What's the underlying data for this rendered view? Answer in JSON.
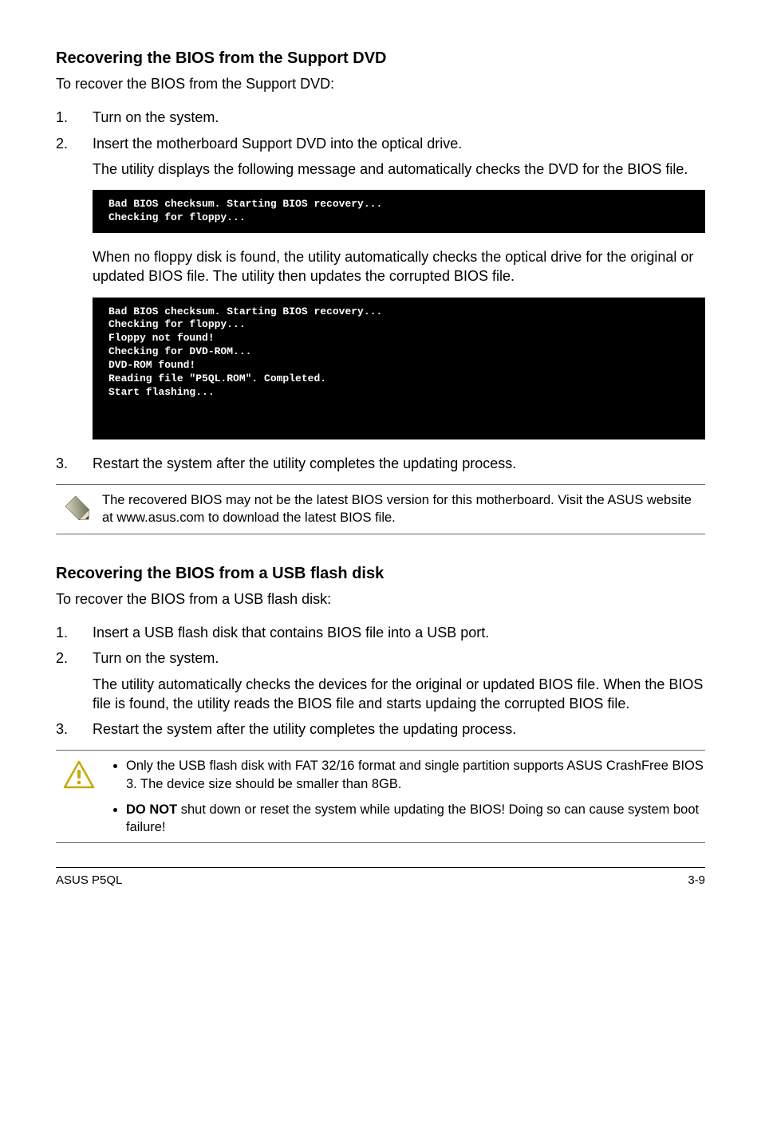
{
  "section1": {
    "heading": "Recovering the BIOS from the Support DVD",
    "intro": "To recover the BIOS from the Support DVD:",
    "steps": [
      {
        "num": "1.",
        "text": "Turn on the system."
      },
      {
        "num": "2.",
        "text": "Insert the motherboard Support DVD into the optical drive.",
        "sub": "The utility displays the following message and automatically checks the DVD for the BIOS file."
      }
    ],
    "terminal1": "Bad BIOS checksum. Starting BIOS recovery...\nChecking for floppy...",
    "mid_p": "When no floppy disk is found, the utility automatically checks the optical drive for the original or updated BIOS file. The utility then updates the corrupted BIOS file.",
    "terminal2": "Bad BIOS checksum. Starting BIOS recovery...\nChecking for floppy...\nFloppy not found!\nChecking for DVD-ROM...\nDVD-ROM found!\nReading file \"P5QL.ROM\". Completed.\nStart flashing...",
    "step3": {
      "num": "3.",
      "text": "Restart the system after the utility completes the updating process."
    },
    "note": "The recovered BIOS may not be the latest BIOS version for this motherboard. Visit the ASUS website at www.asus.com to download the latest BIOS file."
  },
  "section2": {
    "heading": "Recovering the BIOS from a USB flash disk",
    "intro": "To recover the BIOS from a USB flash disk:",
    "steps": [
      {
        "num": "1.",
        "text": "Insert a USB flash disk that contains BIOS file into a USB port."
      },
      {
        "num": "2.",
        "text": "Turn on the system.",
        "sub": "The utility automatically checks the devices for the original or updated BIOS file. When the BIOS file is found, the utility reads the BIOS file and starts updaing the corrupted BIOS file."
      },
      {
        "num": "3.",
        "text": "Restart the system after the utility completes the updating process."
      }
    ],
    "warn": {
      "b1": "Only the USB flash disk with FAT 32/16 format and single partition supports ASUS CrashFree BIOS 3. The device size should be smaller than 8GB.",
      "b2_strong": "DO NOT",
      "b2_rest": " shut down or reset the system while updating the BIOS! Doing so can cause system boot failure!"
    }
  },
  "footer": {
    "left": "ASUS P5QL",
    "right": "3-9"
  }
}
